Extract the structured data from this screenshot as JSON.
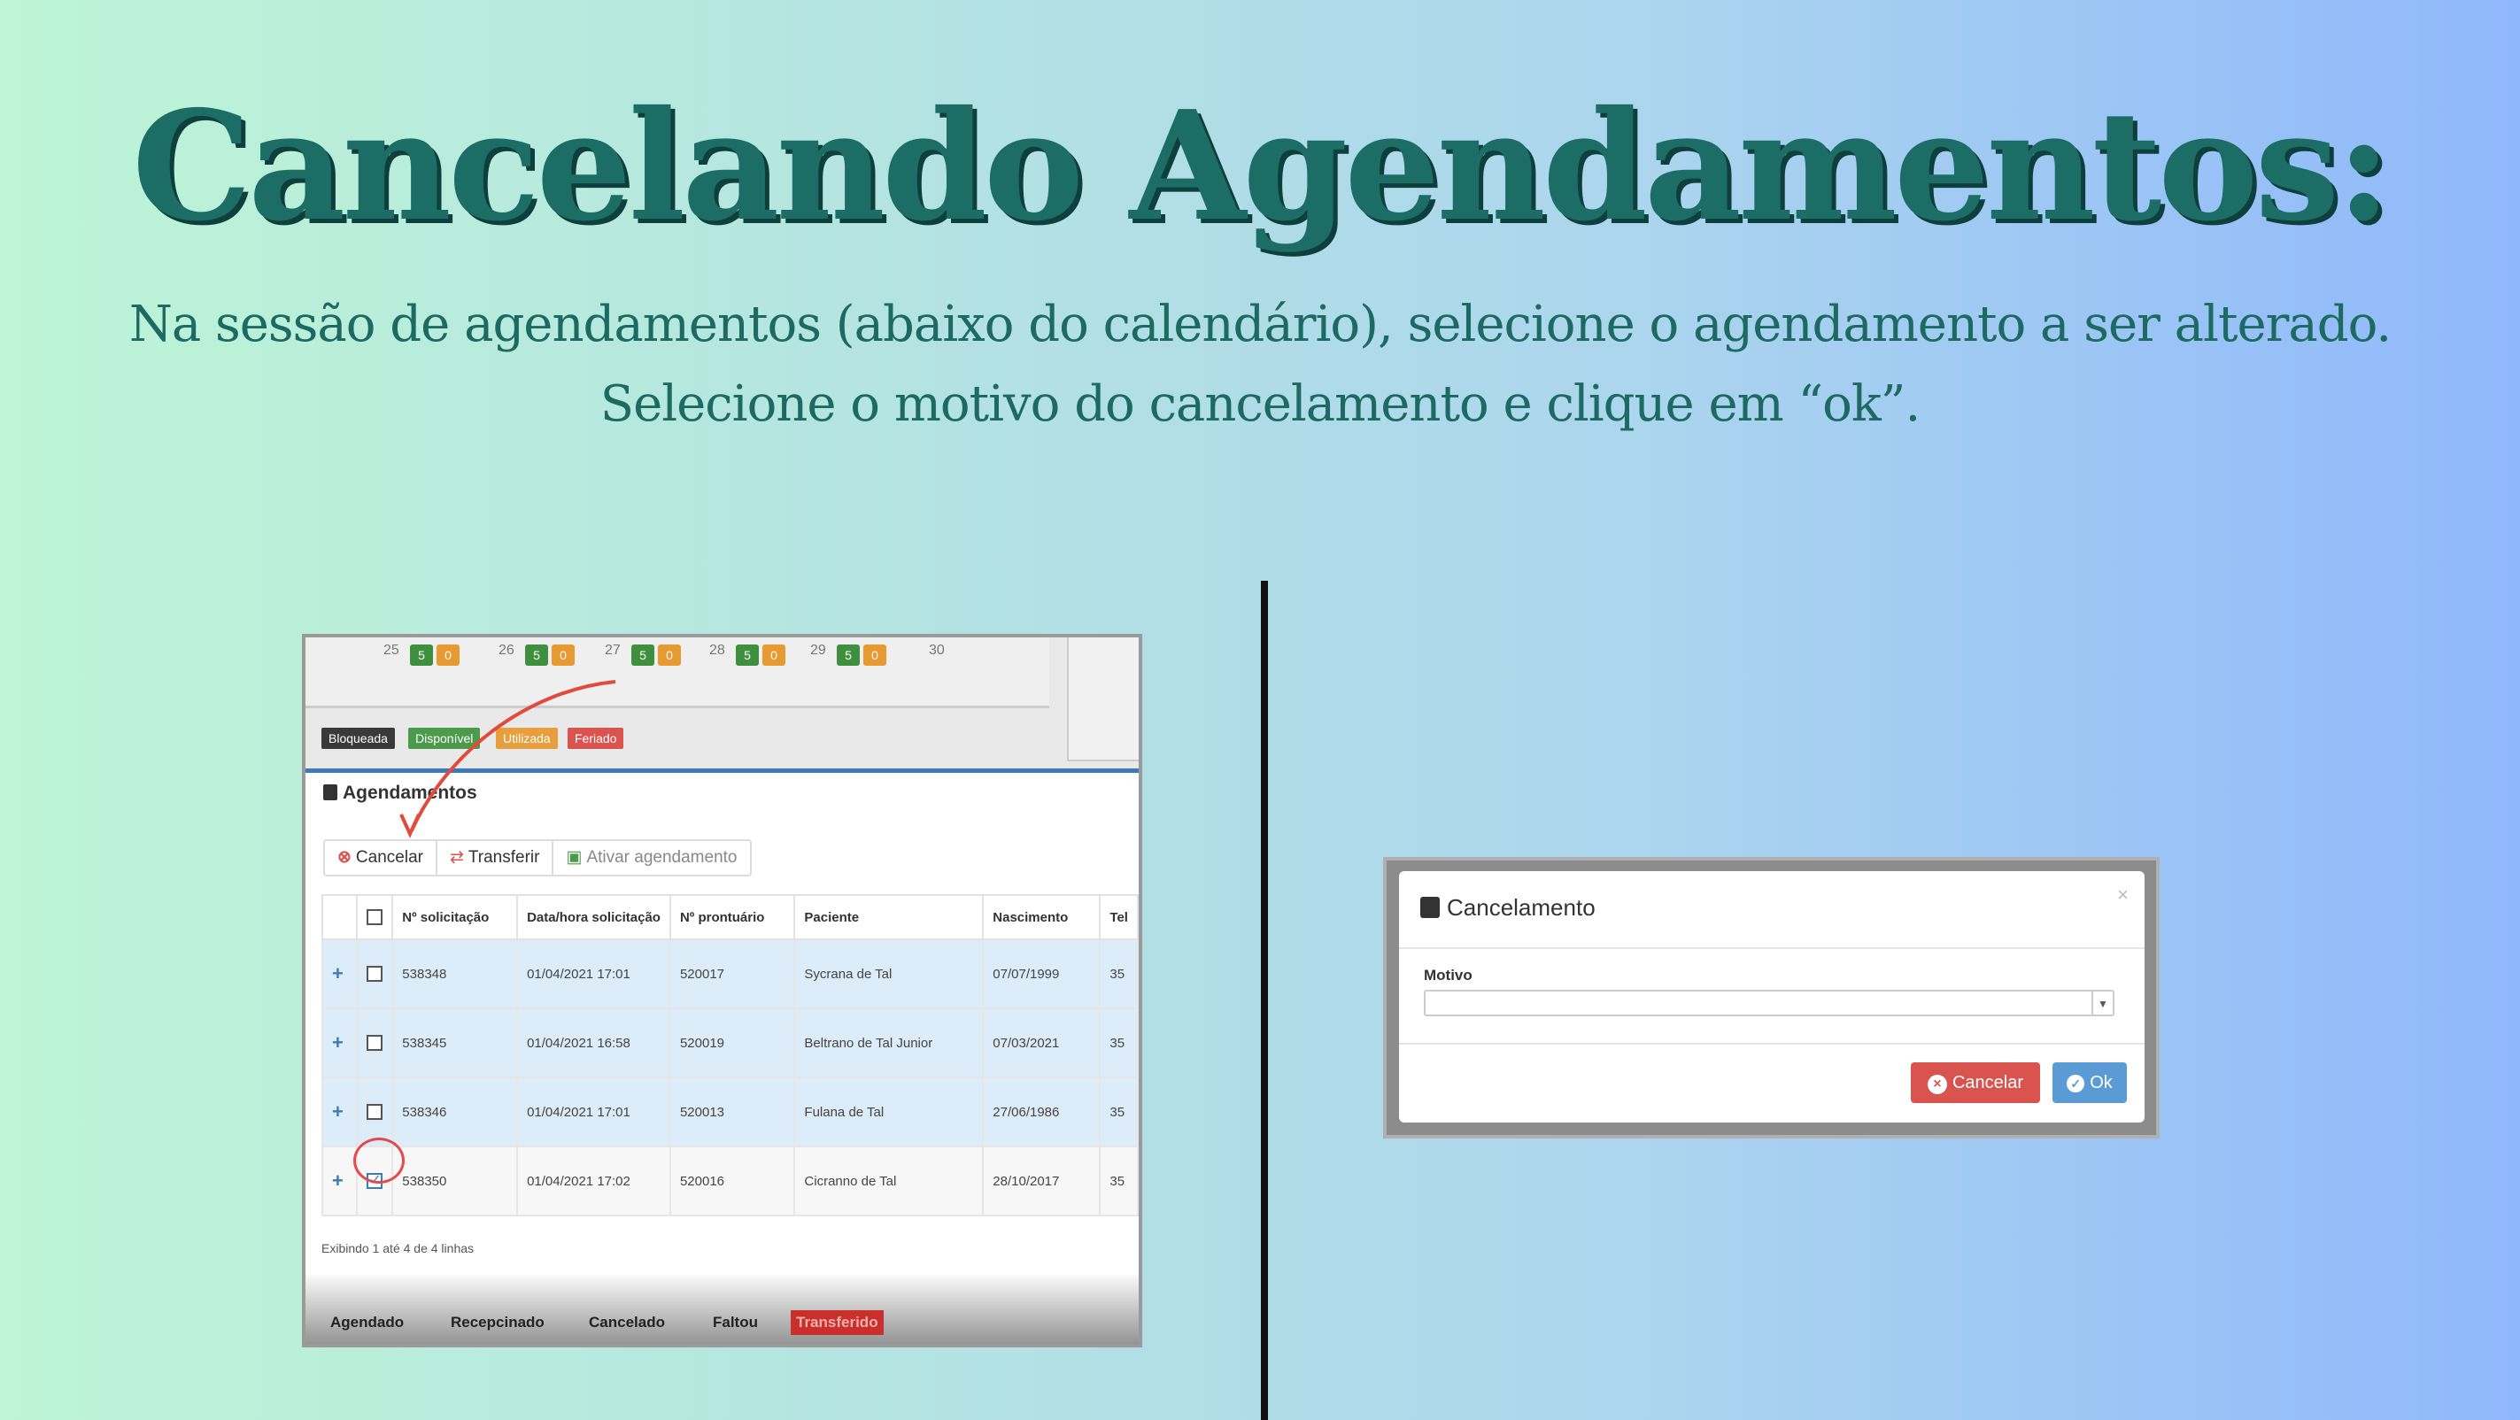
{
  "slide": {
    "title": "Cancelando  Agendamentos:",
    "subtitle_line1": "Na sessão de agendamentos (abaixo do calendário), selecione o agendamento a ser alterado.",
    "subtitle_line2": "Selecione o motivo do cancelamento e clique em “ok”."
  },
  "left_screenshot": {
    "calendar_days": [
      {
        "day": "25",
        "a": "5",
        "b": "0"
      },
      {
        "day": "26",
        "a": "5",
        "b": "0"
      },
      {
        "day": "27",
        "a": "5",
        "b": "0"
      },
      {
        "day": "28",
        "a": "5",
        "b": "0"
      },
      {
        "day": "29",
        "a": "5",
        "b": "0"
      },
      {
        "day": "30"
      }
    ],
    "legend": {
      "bloqueada": "Bloqueada",
      "disponivel": "Disponível",
      "utilizada": "Utilizada",
      "feriado": "Feriado"
    },
    "panel_title": "Agendamentos",
    "toolbar": {
      "cancelar": "Cancelar",
      "transferir": "Transferir",
      "ativar": "Ativar agendamento"
    },
    "table": {
      "headers": [
        "Nº solicitação",
        "Data/hora solicitação",
        "Nº prontuário",
        "Paciente",
        "Nascimento",
        "Tel"
      ],
      "rows": [
        {
          "id": "538348",
          "datetime": "01/04/2021 17:01",
          "prontuario": "520017",
          "paciente": "Sycrana de Tal",
          "nascimento": "07/07/1999",
          "tel": "35"
        },
        {
          "id": "538345",
          "datetime": "01/04/2021 16:58",
          "prontuario": "520019",
          "paciente": "Beltrano de Tal Junior",
          "nascimento": "07/03/2021",
          "tel": "35"
        },
        {
          "id": "538346",
          "datetime": "01/04/2021 17:01",
          "prontuario": "520013",
          "paciente": "Fulana de Tal",
          "nascimento": "27/06/1986",
          "tel": "35"
        },
        {
          "id": "538350",
          "datetime": "01/04/2021 17:02",
          "prontuario": "520016",
          "paciente": "Cicranno de Tal",
          "nascimento": "28/10/2017",
          "tel": "35"
        }
      ]
    },
    "footer_info": "Exibindo 1 até 4 de 4 linhas",
    "status_legend": {
      "agendado": "Agendado",
      "recepcionado": "Recepcinado",
      "cancelado": "Cancelado",
      "faltou": "Faltou",
      "transferido": "Transferido"
    }
  },
  "right_screenshot": {
    "modal_title": "Cancelamento",
    "close": "×",
    "motivo_label": "Motivo",
    "motivo_value": "",
    "cancel_button": "Cancelar",
    "ok_button": "Ok"
  },
  "colors": {
    "title": "#1b6d66",
    "danger": "#d9534f",
    "primary": "#5b9bd5",
    "success": "#4c9a4c",
    "warning": "#e89a32"
  }
}
